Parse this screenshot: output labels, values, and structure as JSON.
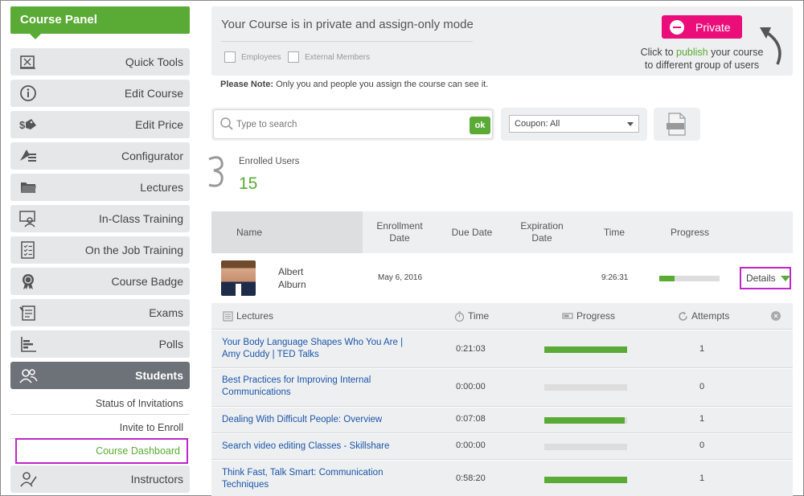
{
  "sidebar": {
    "title": "Course Panel",
    "items": [
      {
        "label": "Quick Tools",
        "icon": "quick-tools-icon"
      },
      {
        "label": "Edit Course",
        "icon": "info-icon"
      },
      {
        "label": "Edit Price",
        "icon": "price-tag-icon"
      },
      {
        "label": "Configurator",
        "icon": "configurator-icon"
      },
      {
        "label": "Lectures",
        "icon": "folder-icon"
      },
      {
        "label": "In-Class Training",
        "icon": "classroom-icon"
      },
      {
        "label": "On the Job Training",
        "icon": "checklist-icon"
      },
      {
        "label": "Course Badge",
        "icon": "badge-icon"
      },
      {
        "label": "Exams",
        "icon": "exam-icon"
      },
      {
        "label": "Polls",
        "icon": "poll-icon"
      },
      {
        "label": "Students",
        "icon": "students-icon",
        "active": true
      },
      {
        "label": "Instructors",
        "icon": "instructor-icon"
      }
    ],
    "sub_items": [
      "Status of Invitations",
      "Invite to Enroll",
      "Course Dashboard"
    ]
  },
  "banner": {
    "title": "Your Course is in private and assign-only mode",
    "checkbox_employees": "Employees",
    "checkbox_external": "External Members",
    "private_label": "Private",
    "publish_prefix": "Click to ",
    "publish_link": "publish",
    "publish_suffix": " your course",
    "publish_line2": "to different group of users"
  },
  "note": {
    "bold": "Please Note:",
    "text": " Only you and people you assign the course can see it."
  },
  "search": {
    "placeholder": "Type to search",
    "ok_label": "ok"
  },
  "coupon": {
    "selected": "Coupon: All"
  },
  "enrolled": {
    "label": "Enrolled Users",
    "count": "15"
  },
  "users_table": {
    "headers": {
      "name": "Name",
      "enrollment": "Enrollment Date",
      "due": "Due Date",
      "expiration": "Expiration Date",
      "time": "Time",
      "progress": "Progress"
    },
    "rows": [
      {
        "first": "Albert",
        "last": "Alburn",
        "enrollment_date": "May 6, 2016",
        "due_date": "",
        "expiration_date": "",
        "time": "9:26:31",
        "progress": 0.25,
        "details_label": "Details"
      }
    ]
  },
  "lectures_table": {
    "headers": {
      "lectures": "Lectures",
      "time": "Time",
      "progress": "Progress",
      "attempts": "Attempts"
    },
    "rows": [
      {
        "title": "Your Body Language Shapes Who You Are | Amy Cuddy | TED Talks",
        "time": "0:21:03",
        "progress": 1.0,
        "attempts": "1"
      },
      {
        "title": "Best Practices for Improving Internal Communications",
        "time": "0:00:00",
        "progress": 0.0,
        "attempts": "0"
      },
      {
        "title": "Dealing With Difficult People: Overview",
        "time": "0:07:08",
        "progress": 0.97,
        "attempts": "1"
      },
      {
        "title": "Search video editing Classes - Skillshare",
        "time": "0:00:00",
        "progress": 0.0,
        "attempts": "0"
      },
      {
        "title": "Think Fast, Talk Smart: Communication Techniques",
        "time": "0:58:20",
        "progress": 1.0,
        "attempts": "1"
      }
    ]
  },
  "colors": {
    "accent": "#5aab35",
    "private": "#ea0d7a",
    "highlight": "#c026c9",
    "link": "#1a56a8"
  }
}
